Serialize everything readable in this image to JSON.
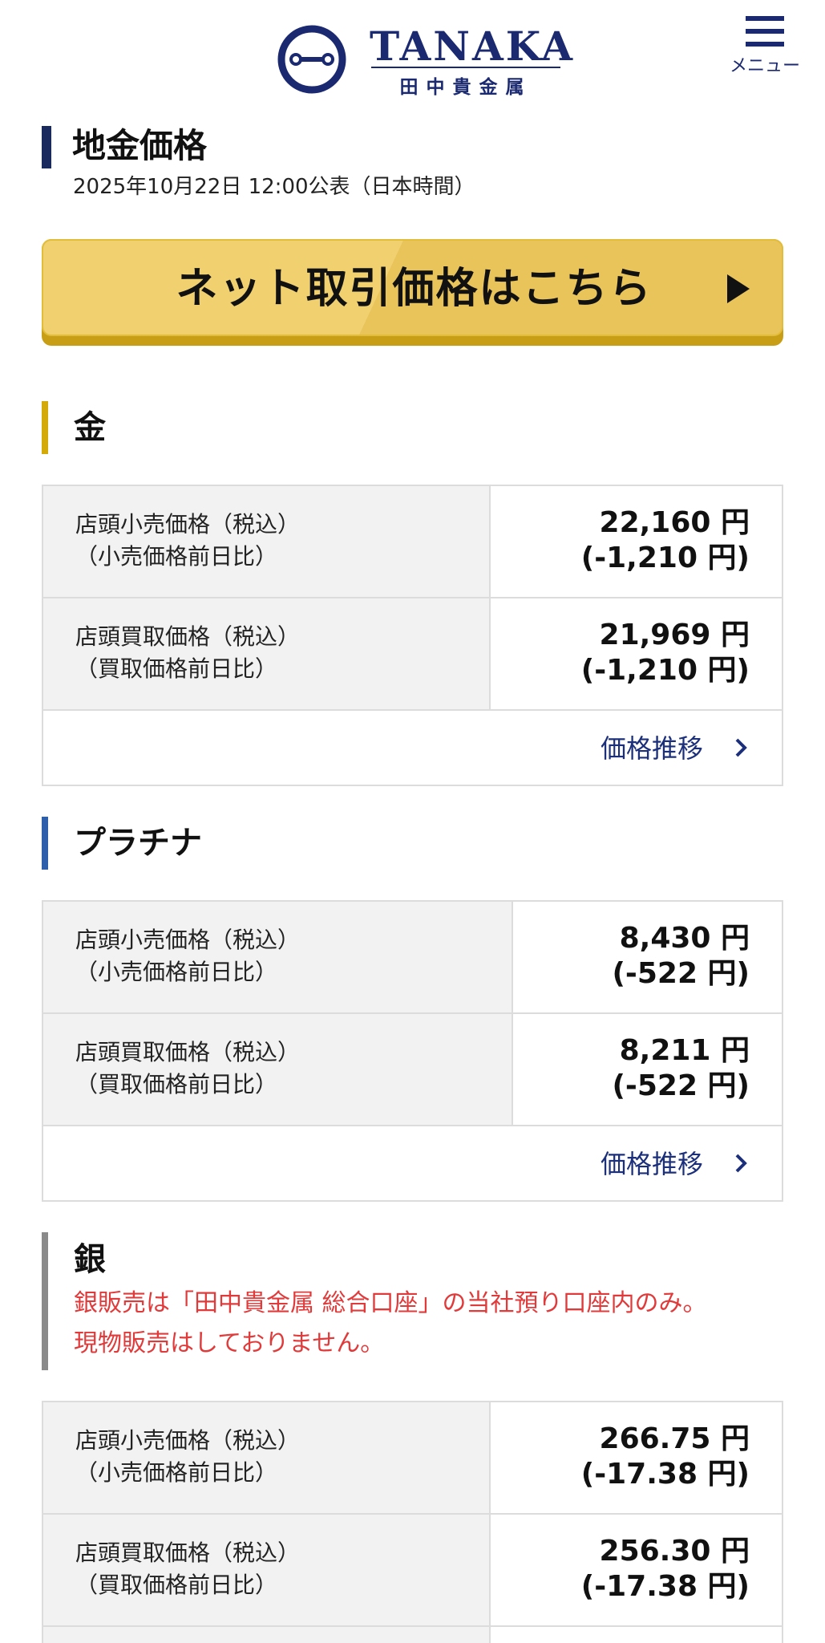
{
  "header": {
    "logo_text": "TANAKA",
    "logo_subtext": "田中貴金属",
    "menu_label": "メニュー",
    "brand_color": "#1b2a70"
  },
  "page": {
    "title": "地金価格",
    "published": "2025年10月22日 12:00公表（日本時間）"
  },
  "cta": {
    "label": "ネット取引価格はこちら",
    "color": "#e9c45b"
  },
  "sections": [
    {
      "title": "金",
      "accent": "#d4a90a",
      "rows": [
        {
          "label1": "店頭小売価格（税込）",
          "label2": "（小売価格前日比）",
          "price": "22,160 円",
          "change": "(-1,210 円)"
        },
        {
          "label1": "店頭買取価格（税込）",
          "label2": "（買取価格前日比）",
          "price": "21,969 円",
          "change": "(-1,210 円)"
        }
      ],
      "trend_label": "価格推移"
    },
    {
      "title": "プラチナ",
      "accent": "#2e5fab",
      "rows": [
        {
          "label1": "店頭小売価格（税込）",
          "label2": "（小売価格前日比）",
          "price": "8,430 円",
          "change": "(-522 円)"
        },
        {
          "label1": "店頭買取価格（税込）",
          "label2": "（買取価格前日比）",
          "price": "8,211 円",
          "change": "(-522 円)"
        }
      ],
      "trend_label": "価格推移"
    },
    {
      "title": "銀",
      "accent": "#8a8a8a",
      "note1": "銀販売は「田中貴金属 総合口座」の当社預り口座内のみ。",
      "note2": "現物販売はしておりません。",
      "rows": [
        {
          "label1": "店頭小売価格（税込）",
          "label2": "（小売価格前日比）",
          "price": "266.75 円",
          "change": "(-17.38 円)"
        },
        {
          "label1": "店頭買取価格（税込）",
          "label2": "（買取価格前日比）",
          "price": "256.30 円",
          "change": "(-17.38 円)"
        }
      ]
    }
  ],
  "icons": {
    "logo": "tanaka-logo-icon",
    "menu": "hamburger-icon",
    "cta_arrow": "play-triangle-icon",
    "trend": "chevron-right-icon"
  }
}
